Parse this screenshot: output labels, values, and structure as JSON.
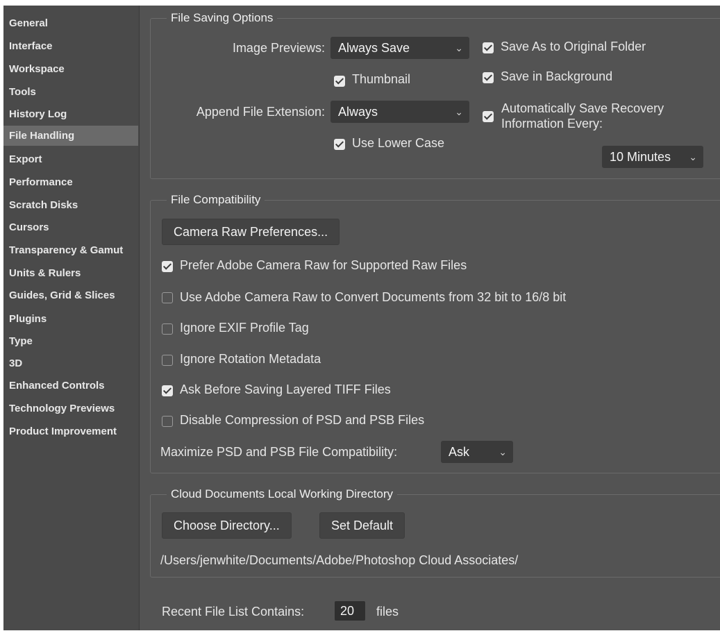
{
  "sidebar": {
    "items": [
      {
        "label": "General"
      },
      {
        "label": "Interface"
      },
      {
        "label": "Workspace"
      },
      {
        "label": "Tools"
      },
      {
        "label": "History Log"
      },
      {
        "label": "File Handling"
      },
      {
        "label": "Export"
      },
      {
        "label": "Performance"
      },
      {
        "label": "Scratch Disks"
      },
      {
        "label": "Cursors"
      },
      {
        "label": "Transparency & Gamut"
      },
      {
        "label": "Units & Rulers"
      },
      {
        "label": "Guides, Grid & Slices"
      },
      {
        "label": "Plugins"
      },
      {
        "label": "Type"
      },
      {
        "label": "3D"
      },
      {
        "label": "Enhanced Controls"
      },
      {
        "label": "Technology Previews"
      },
      {
        "label": "Product Improvement"
      }
    ],
    "active": "File Handling"
  },
  "file_saving": {
    "title": "File Saving Options",
    "image_previews_label": "Image Previews:",
    "image_previews_value": "Always Save",
    "thumbnail_label": "Thumbnail",
    "thumbnail_checked": true,
    "append_ext_label": "Append File Extension:",
    "append_ext_value": "Always",
    "lower_case_label": "Use Lower Case",
    "lower_case_checked": true,
    "save_original_label": "Save As to Original Folder",
    "save_original_checked": true,
    "save_background_label": "Save in Background",
    "save_background_checked": true,
    "auto_recovery_line1": "Automatically Save Recovery",
    "auto_recovery_line2": "Information Every:",
    "auto_recovery_checked": true,
    "recovery_interval": "10 Minutes"
  },
  "compat": {
    "title": "File Compatibility",
    "camera_raw_button": "Camera Raw Preferences...",
    "options": [
      {
        "label": "Prefer Adobe Camera Raw for Supported Raw Files",
        "checked": true
      },
      {
        "label": "Use Adobe Camera Raw to Convert Documents from 32 bit to 16/8 bit",
        "checked": false
      },
      {
        "label": "Ignore EXIF Profile Tag",
        "checked": false
      },
      {
        "label": "Ignore Rotation Metadata",
        "checked": false
      },
      {
        "label": "Ask Before Saving Layered TIFF Files",
        "checked": true
      },
      {
        "label": "Disable Compression of PSD and PSB Files",
        "checked": false
      }
    ],
    "maximize_label": "Maximize PSD and PSB File Compatibility:",
    "maximize_value": "Ask"
  },
  "cloud": {
    "title": "Cloud Documents Local Working Directory",
    "choose_button": "Choose Directory...",
    "default_button": "Set Default",
    "path": "/Users/jenwhite/Documents/Adobe/Photoshop Cloud Associates/"
  },
  "recent": {
    "label": "Recent File List Contains:",
    "value": "20",
    "suffix": "files"
  },
  "icons": {
    "dropdown": "chevron-down-icon",
    "check": "checkmark-icon"
  },
  "colors": {
    "panel_bg": "#535353",
    "sidebar_bg": "#4a4a4a",
    "active_item_bg": "#6a6a6a",
    "field_bg": "#3a3a3a"
  }
}
